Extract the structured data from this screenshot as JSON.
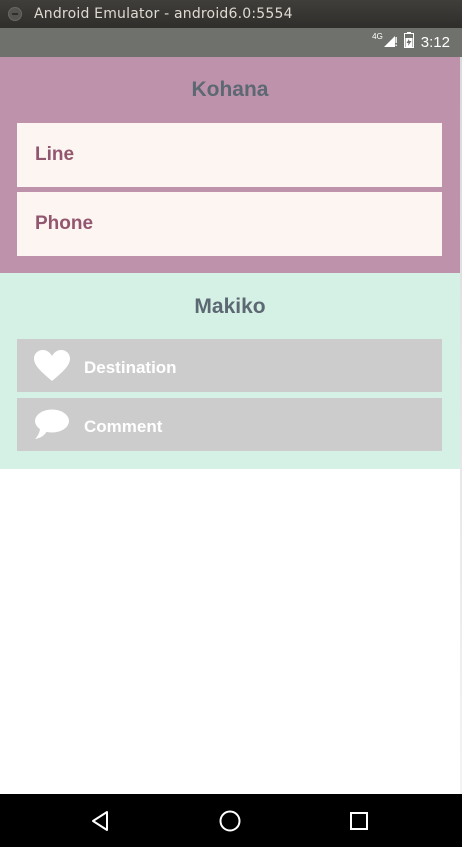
{
  "window": {
    "title": "Android Emulator - android6.0:5554"
  },
  "status_bar": {
    "network": "4G",
    "time": "3:12",
    "icons": [
      "signal-icon",
      "battery-icon"
    ]
  },
  "kohana": {
    "title": "Kohana",
    "fields": [
      {
        "label": "Line"
      },
      {
        "label": "Phone"
      }
    ],
    "colors": {
      "background": "#bf92ac",
      "field": "#fdf5f1",
      "label": "#93566f"
    }
  },
  "makiko": {
    "title": "Makiko",
    "fields": [
      {
        "label": "Destination",
        "icon": "heart-icon"
      },
      {
        "label": "Comment",
        "icon": "comment-icon"
      }
    ],
    "colors": {
      "background": "#d5f0e5",
      "field": "#cccccc",
      "label": "#ffffff"
    }
  },
  "nav_bar": {
    "icons": [
      "back-icon",
      "home-icon",
      "recents-icon"
    ]
  }
}
